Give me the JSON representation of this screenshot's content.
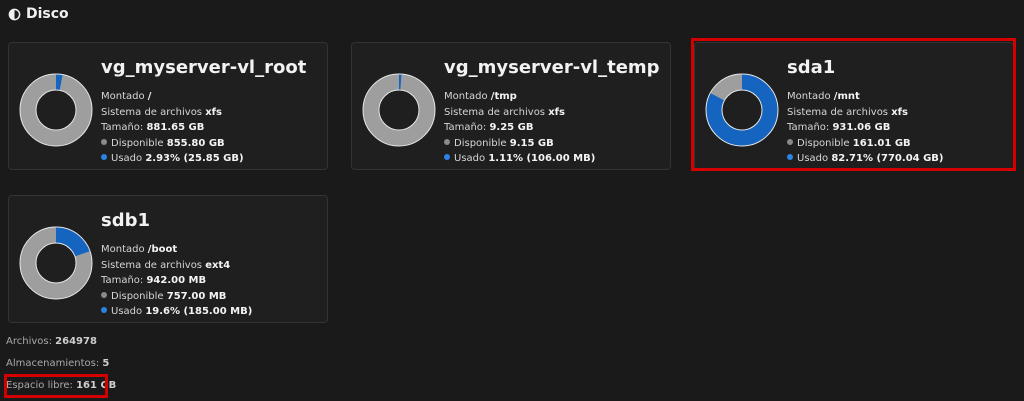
{
  "header": {
    "title": "Disco",
    "icon": "disk-usage-icon"
  },
  "colors": {
    "used": "#1565c0",
    "free": "#9e9e9e",
    "accent_used_dot": "#2b83e6",
    "highlight": "#d40000"
  },
  "labels": {
    "mounted": "Montado",
    "filesystem": "Sistema de archivos",
    "size": "Tamaño:",
    "available": "Disponible",
    "used": "Usado"
  },
  "disks": [
    {
      "name": "vg_myserver-vl_root",
      "mount": "/",
      "fs": "xfs",
      "size": "881.65 GB",
      "available": "855.80 GB",
      "used": "2.93% (25.85 GB)",
      "used_fraction": 0.0293
    },
    {
      "name": "vg_myserver-vl_temp",
      "mount": "/tmp",
      "fs": "xfs",
      "size": "9.25 GB",
      "available": "9.15 GB",
      "used": "1.11% (106.00 MB)",
      "used_fraction": 0.0111
    },
    {
      "name": "sda1",
      "mount": "/mnt",
      "fs": "xfs",
      "size": "931.06 GB",
      "available": "161.01 GB",
      "used": "82.71% (770.04 GB)",
      "used_fraction": 0.8271
    },
    {
      "name": "sdb1",
      "mount": "/boot",
      "fs": "ext4",
      "size": "942.00 MB",
      "available": "757.00 MB",
      "used": "19.6% (185.00 MB)",
      "used_fraction": 0.196
    }
  ],
  "stats": {
    "files_label": "Archivos:",
    "files_value": "264978",
    "storages_label": "Almacenamientos:",
    "storages_value": "5",
    "free_label": "Espacio libre:",
    "free_value": "161 GB"
  }
}
